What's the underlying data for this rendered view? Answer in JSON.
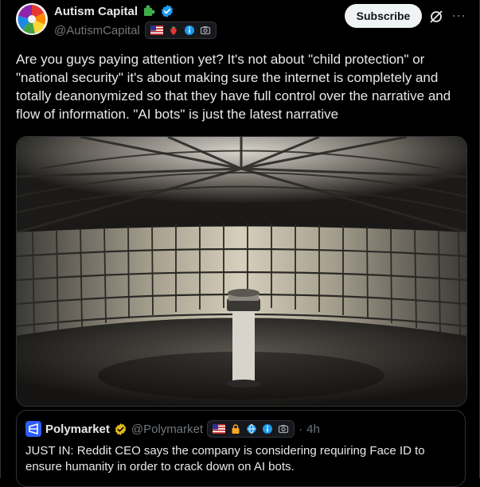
{
  "author": {
    "display_name": "Autism Capital",
    "handle": "@AutismCapital",
    "badge_icons": [
      "us-flag-icon",
      "strawberry-icon",
      "info-icon",
      "camera-icon"
    ]
  },
  "actions": {
    "subscribe_label": "Subscribe",
    "grok_icon": "grok-icon",
    "more_icon": "more-icon"
  },
  "tweet": {
    "text": "Are you guys paying attention yet? It's not about \"child protection\" or\n\"national security\" it's about making sure the internet is completely and\ntotally deanonymized so that they have full control over the narrative and\nflow of information. \"AI bots\" is just the latest narrative"
  },
  "media": {
    "description": "panopticon prison interior"
  },
  "quoted_tweet": {
    "display_name": "Polymarket",
    "handle": "@Polymarket",
    "separator": "·",
    "time": "4h",
    "text": "JUST IN: Reddit CEO says the company is considering requiring Face ID to ensure humanity in order to crack down on AI bots."
  },
  "colors": {
    "background": "#000000",
    "verified_blue": "#1d9bf0",
    "gold_check": "#e2b719",
    "polymarket_blue": "#2e5cff",
    "muted": "#71767b"
  }
}
